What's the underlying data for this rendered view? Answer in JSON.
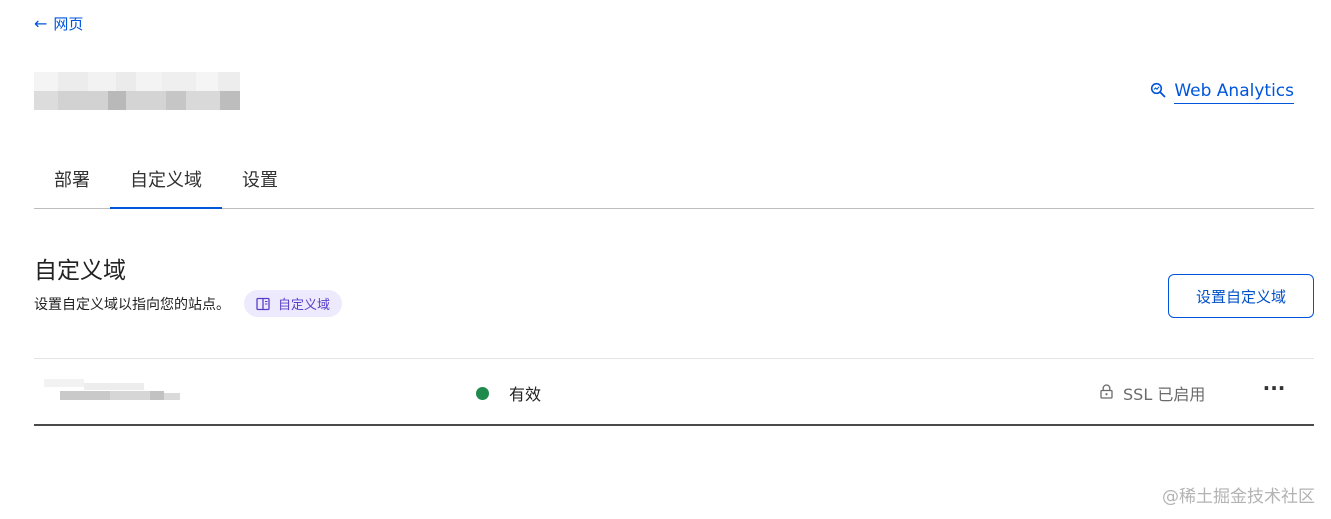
{
  "nav": {
    "back_label": "网页"
  },
  "header": {
    "web_analytics_label": "Web Analytics"
  },
  "tabs": [
    {
      "label": "部署"
    },
    {
      "label": "自定义域"
    },
    {
      "label": "设置"
    }
  ],
  "section": {
    "title": "自定义域",
    "description": "设置自定义域以指向您的站点。",
    "doc_chip_label": "自定义域",
    "setup_button_label": "设置自定义域"
  },
  "domains": [
    {
      "status": "有效",
      "ssl": "SSL 已启用"
    }
  ],
  "colors": {
    "accent": "#0055dc",
    "status_ok": "#1e8a4c",
    "chip_bg": "#eeeafe",
    "chip_text": "#5a3ec8"
  },
  "watermark": "@稀土掘金技术社区"
}
